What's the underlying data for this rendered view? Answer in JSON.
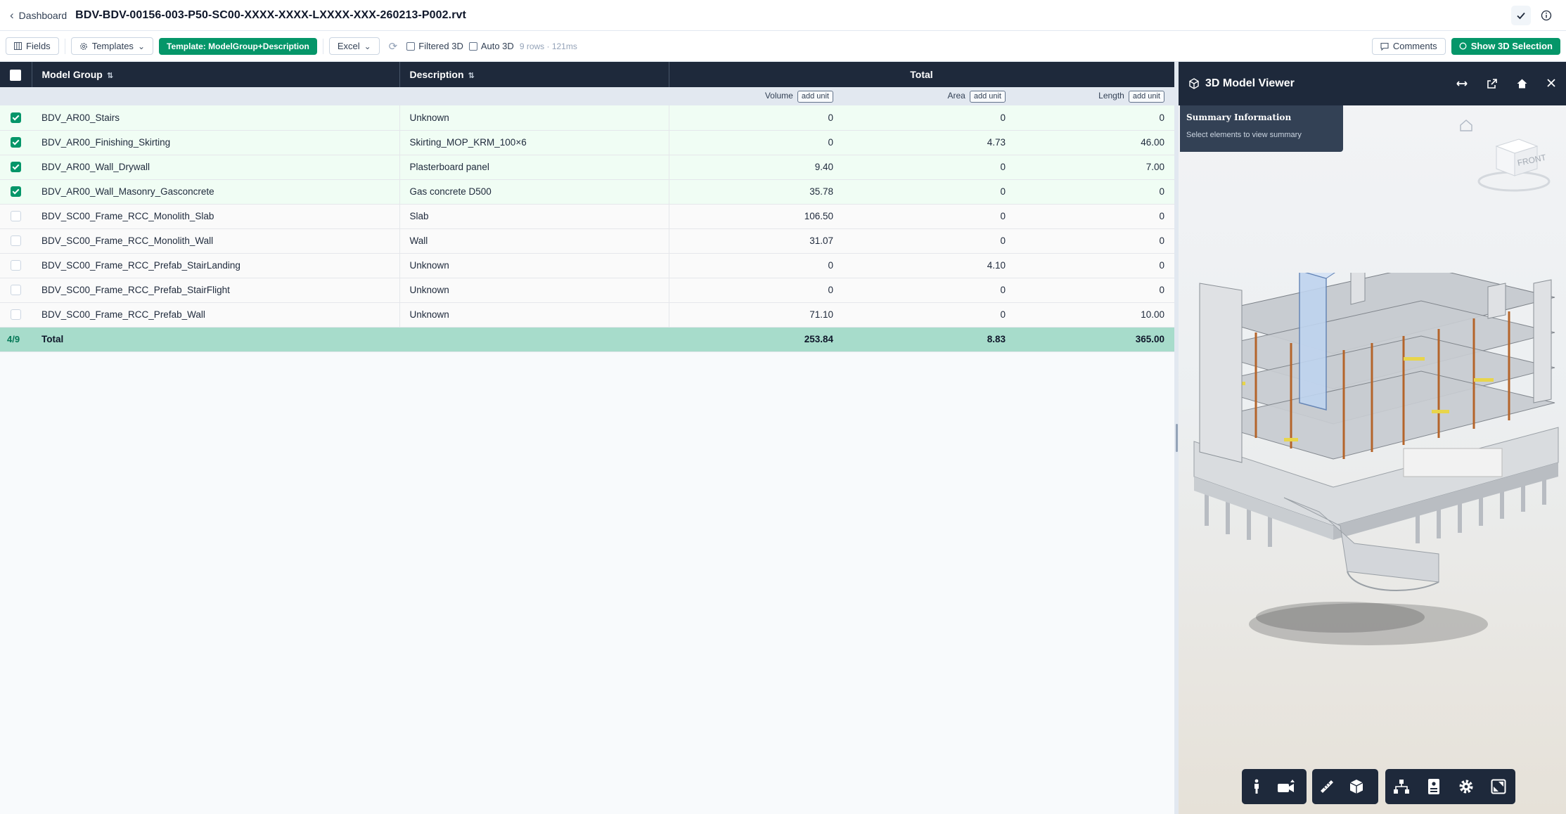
{
  "header": {
    "back_label": "Dashboard",
    "file_name": "BDV-BDV-00156-003-P50-SC00-XXXX-XXXX-LXXXX-XXX-260213-P002.rvt",
    "back_icon": "chevron-left-icon",
    "right_icons": [
      "check-icon",
      "info-icon"
    ]
  },
  "toolbar": {
    "fields_label": "Fields",
    "templates_label": "Templates",
    "template_badge": "Template: ModelGroup+Description",
    "excel_label": "Excel",
    "filtered3d_label": "Filtered 3D",
    "auto3d_label": "Auto 3D",
    "rows_info": "9 rows · 121ms",
    "comments_label": "Comments",
    "show3d_label": "Show 3D Selection"
  },
  "table": {
    "columns": {
      "model_group": "Model Group",
      "description": "Description",
      "total": "Total",
      "volume": "Volume",
      "area": "Area",
      "length": "Length",
      "add_unit": "add unit"
    },
    "rows": [
      {
        "model_group": "BDV_AR00_Stairs",
        "description": "Unknown",
        "volume": "0",
        "area": "0",
        "length": "0",
        "checked": true
      },
      {
        "model_group": "BDV_AR00_Finishing_Skirting",
        "description": "Skirting_MOP_KRM_100×6",
        "volume": "0",
        "area": "4.73",
        "length": "46.00",
        "checked": true
      },
      {
        "model_group": "BDV_AR00_Wall_Drywall",
        "description": "Plasterboard panel",
        "volume": "9.40",
        "area": "0",
        "length": "7.00",
        "checked": true
      },
      {
        "model_group": "BDV_AR00_Wall_Masonry_Gasconcrete",
        "description": "Gas concrete D500",
        "volume": "35.78",
        "area": "0",
        "length": "0",
        "checked": true
      },
      {
        "model_group": "BDV_SC00_Frame_RCC_Monolith_Slab",
        "description": "Slab",
        "volume": "106.50",
        "area": "0",
        "length": "0",
        "checked": false
      },
      {
        "model_group": "BDV_SC00_Frame_RCC_Monolith_Wall",
        "description": "Wall",
        "volume": "31.07",
        "area": "0",
        "length": "0",
        "checked": false
      },
      {
        "model_group": "BDV_SC00_Frame_RCC_Prefab_StairLanding",
        "description": "Unknown",
        "volume": "0",
        "area": "4.10",
        "length": "0",
        "checked": false
      },
      {
        "model_group": "BDV_SC00_Frame_RCC_Prefab_StairFlight",
        "description": "Unknown",
        "volume": "0",
        "area": "0",
        "length": "0",
        "checked": false
      },
      {
        "model_group": "BDV_SC00_Frame_RCC_Prefab_Wall",
        "description": "Unknown",
        "volume": "71.10",
        "area": "0",
        "length": "10.00",
        "checked": false
      }
    ],
    "total_row": {
      "count": "4/9",
      "label": "Total",
      "volume": "253.84",
      "area": "8.83",
      "length": "365.00"
    }
  },
  "viewer": {
    "title": "3D Model Viewer",
    "header_icons": [
      "swap-horizontal-icon",
      "external-link-icon",
      "home-icon",
      "close-icon"
    ],
    "summary_title": "Summary Information",
    "summary_subtitle": "Select elements to view summary",
    "navcube_label": "FRONT",
    "bottom_tools": [
      "walk-person-icon",
      "camera-icon",
      "measure-ruler-icon",
      "section-box-icon",
      "model-tree-icon",
      "properties-icon",
      "settings-gear-icon",
      "fullscreen-icon"
    ]
  },
  "colors": {
    "accent_green": "#059669",
    "header_dark": "#1e293b",
    "total_row_bg": "#a7dccb",
    "selected_row_bg": "#f0fdf4"
  }
}
